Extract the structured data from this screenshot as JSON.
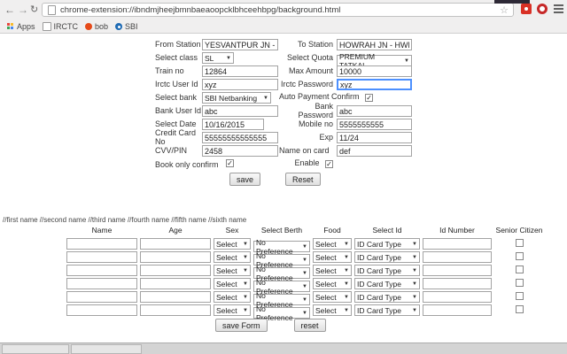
{
  "browser": {
    "url": "chrome-extension://ibndmjheejbmnbaeaoopcklbhceehbpg/background.html",
    "bookmarks": [
      {
        "label": "Apps"
      },
      {
        "label": "IRCTC"
      },
      {
        "label": "bob"
      },
      {
        "label": "SBI"
      }
    ]
  },
  "colors": {
    "focus_border": "#4d90fe",
    "toolbar_bg": "#f0efef"
  },
  "booking": {
    "fields": {
      "from_station": {
        "label": "From Station",
        "value": "YESVANTPUR JN - YPR"
      },
      "to_station": {
        "label": "To Station",
        "value": "HOWRAH JN - HWH"
      },
      "select_class": {
        "label": "Select class",
        "value": "SL"
      },
      "select_quota": {
        "label": "Select Quota",
        "value": "PREMIUM TATKAL"
      },
      "train_no": {
        "label": "Train no",
        "value": "12864"
      },
      "max_amount": {
        "label": "Max Amount",
        "value": "10000"
      },
      "irctc_user_id": {
        "label": "Irctc User Id",
        "value": "xyz"
      },
      "irctc_password": {
        "label": "Irctc Password",
        "value": "xyz",
        "focused": true
      },
      "select_bank": {
        "label": "Select bank",
        "value": "SBI Netbanking"
      },
      "auto_payment_confirm": {
        "label": "Auto Payment Confirm",
        "checked": true
      },
      "bank_user_id": {
        "label": "Bank User Id",
        "value": "abc"
      },
      "bank_password": {
        "label": "Bank Password",
        "value": "abc"
      },
      "select_date": {
        "label": "Select Date",
        "value": "10/16/2015"
      },
      "mobile_no": {
        "label": "Mobile no",
        "value": "5555555555"
      },
      "credit_card_no": {
        "label": "Credit Card No",
        "value": "55555555555555"
      },
      "exp": {
        "label": "Exp",
        "value": "11/24"
      },
      "cvv_pin": {
        "label": "CVV/PIN",
        "value": "2458"
      },
      "name_on_card": {
        "label": "Name on card",
        "value": "def"
      },
      "book_only_confirm": {
        "label": "Book only confirm",
        "checked": true
      },
      "enable": {
        "label": "Enable",
        "checked": true
      }
    },
    "save_label": "save",
    "reset_label": "Reset"
  },
  "passenger_form": {
    "note": "//first name //second name //third name //fourth name //fifth name //sixth name",
    "headers": [
      "Name",
      "Age",
      "Sex",
      "Select Berth",
      "Food",
      "Select Id",
      "Id Number",
      "Senior Citizen"
    ],
    "defaults": {
      "sex": "Select",
      "berth": "No Preference",
      "food": "Select",
      "id_type": "ID Card Type"
    },
    "row_count": 6,
    "save_label": "save Form",
    "reset_label": "reset"
  }
}
